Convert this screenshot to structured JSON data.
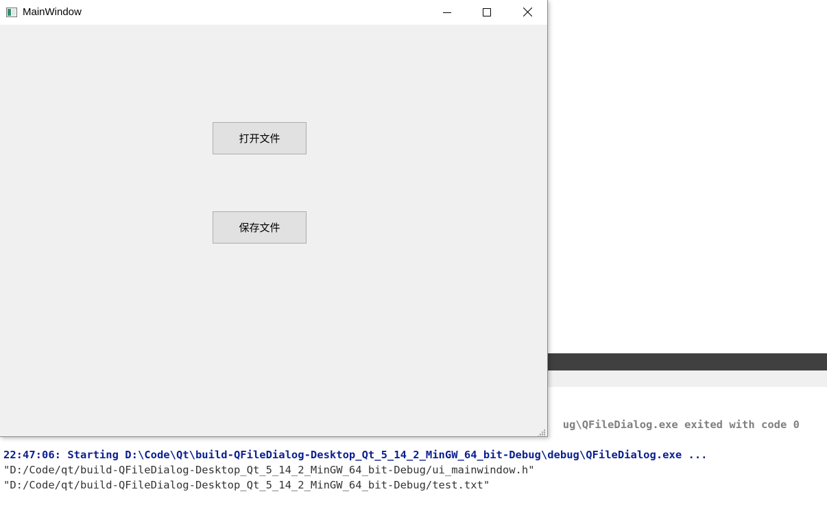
{
  "window": {
    "title": "MainWindow",
    "buttons": {
      "open_file": "打开文件",
      "save_file": "保存文件"
    }
  },
  "output": {
    "exited_line": "ug\\QFileDialog.exe exited with code 0",
    "start_line": "22:47:06: Starting D:\\Code\\Qt\\build-QFileDialog-Desktop_Qt_5_14_2_MinGW_64_bit-Debug\\debug\\QFileDialog.exe ...",
    "lines": [
      "\"D:/Code/qt/build-QFileDialog-Desktop_Qt_5_14_2_MinGW_64_bit-Debug/ui_mainwindow.h\"",
      "\"D:/Code/qt/build-QFileDialog-Desktop_Qt_5_14_2_MinGW_64_bit-Debug/test.txt\""
    ]
  },
  "colors": {
    "start_line": "#0b1f8f",
    "exited_line": "#7f7f7f",
    "window_bg": "#f0f0f0",
    "button_bg": "#e1e1e1"
  },
  "icons": [
    "app-icon",
    "minimize-icon",
    "maximize-icon",
    "close-icon",
    "resize-grip-icon"
  ]
}
